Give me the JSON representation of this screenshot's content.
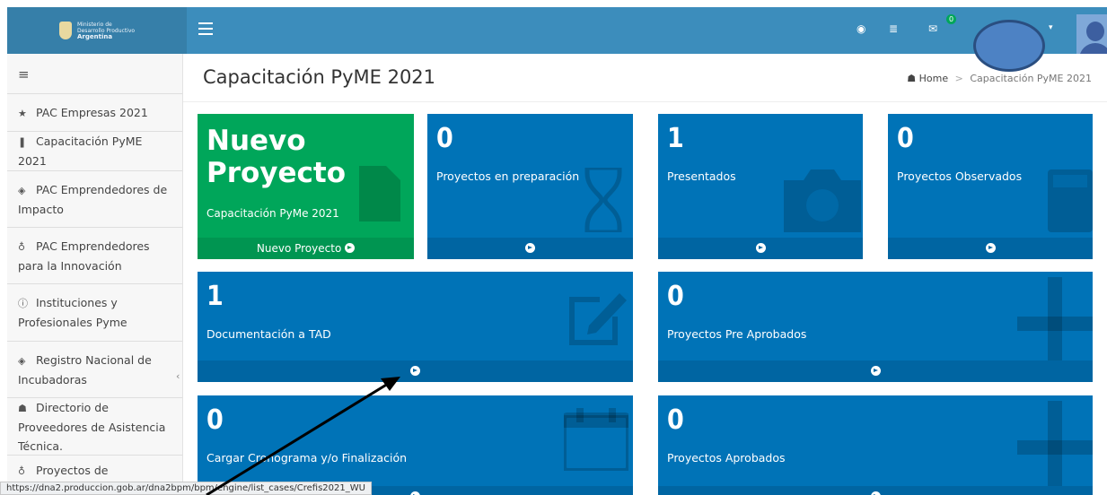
{
  "logo": {
    "line1": "Ministerio de",
    "line2": "Desarrollo Productivo",
    "line3": "Argentina"
  },
  "topbar": {
    "notification_count": "0"
  },
  "sidebar": {
    "items": [
      {
        "icon": "★",
        "label": "PAC Empresas 2021"
      },
      {
        "icon": "❚",
        "label": "Capacitación PyME 2021"
      },
      {
        "icon": "◈",
        "label": "PAC Emprendedores de Impacto"
      },
      {
        "icon": "♁",
        "label": "PAC Emprendedores para la Innovación"
      },
      {
        "icon": "ⓘ",
        "label": "Instituciones y Profesionales Pyme"
      },
      {
        "icon": "◈",
        "label": "Registro Nacional de Incubadoras"
      },
      {
        "icon": "☗",
        "label": "Directorio de Proveedores de Asistencia Técnica."
      },
      {
        "icon": "♁",
        "label": "Proyectos de Capacitación"
      }
    ]
  },
  "page": {
    "title": "Capacitación PyME 2021",
    "breadcrumb_home": "Home",
    "breadcrumb_current": "Capacitación PyME 2021"
  },
  "boxes": {
    "nuevo": {
      "line1": "Nuevo",
      "line2": "Proyecto",
      "subtitle": "Capacitación PyMe 2021",
      "footer": "Nuevo Proyecto"
    },
    "preparacion": {
      "value": "0",
      "label": "Proyectos en preparación"
    },
    "presentados": {
      "value": "1",
      "label": "Presentados"
    },
    "observados": {
      "value": "0",
      "label": "Proyectos Observados"
    },
    "tad": {
      "value": "1",
      "label": "Documentación a TAD"
    },
    "preaprobados": {
      "value": "0",
      "label": "Proyectos Pre Aprobados"
    },
    "cronograma": {
      "value": "0",
      "label": "Cargar Cronograma y/o Finalización"
    },
    "aprobados": {
      "value": "0",
      "label": "Proyectos Aprobados"
    }
  },
  "status_bar": {
    "url": "https://dna2.produccion.gob.ar/dna2bpm/bpm/engine/list_cases/Crefis2021_WU"
  },
  "colors": {
    "topbar": "#3c8dbc",
    "box_blue": "#0073b7",
    "box_green": "#00a65a"
  }
}
